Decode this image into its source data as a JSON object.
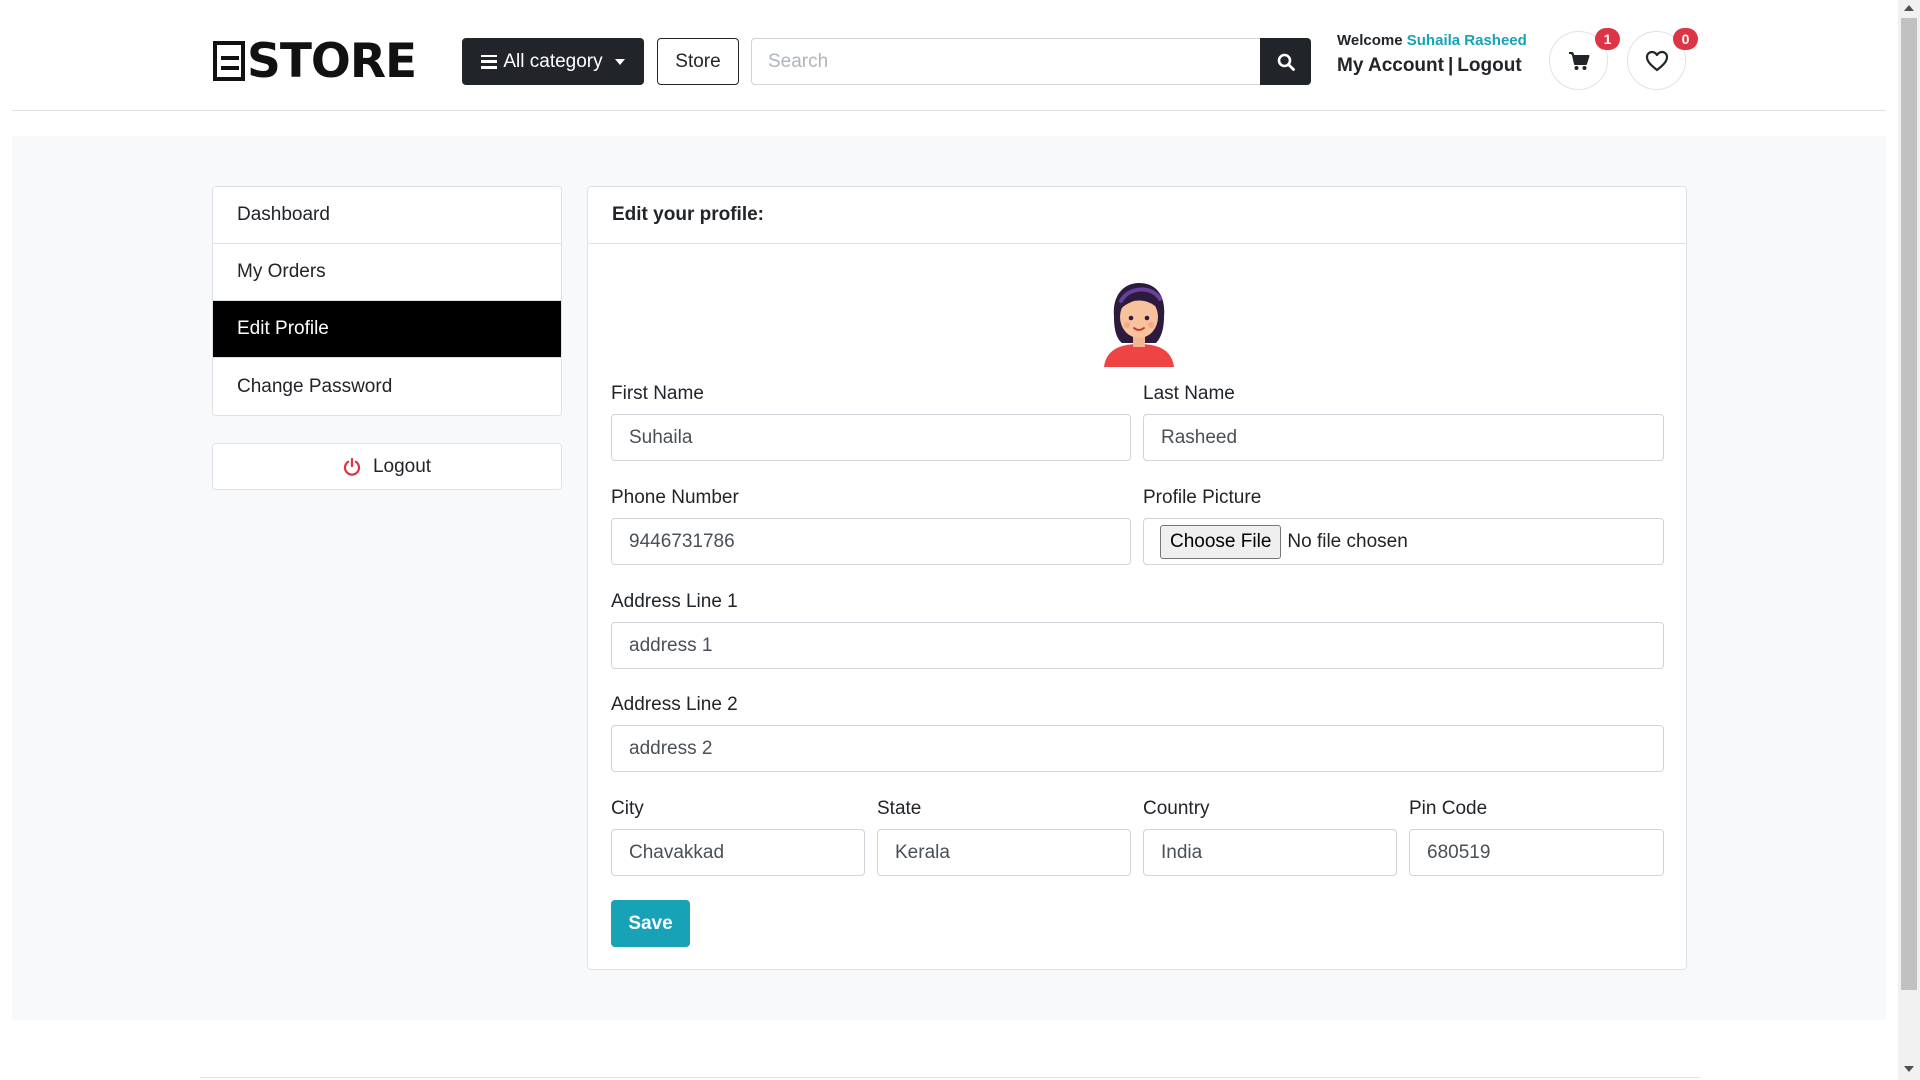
{
  "header": {
    "logo_text": "STORE",
    "category_label": "All category",
    "store_label": "Store",
    "search_placeholder": "Search",
    "welcome_prefix": "Welcome",
    "user_name": "Suhaila Rasheed",
    "my_account_label": "My Account",
    "separator": "|",
    "logout_label": "Logout",
    "cart_count": "1",
    "wishlist_count": "0"
  },
  "sidebar": {
    "items": [
      {
        "label": "Dashboard",
        "active": false
      },
      {
        "label": "My Orders",
        "active": false
      },
      {
        "label": "Edit Profile",
        "active": true
      },
      {
        "label": "Change Password",
        "active": false
      }
    ],
    "logout_label": "Logout"
  },
  "profile": {
    "title": "Edit your profile:",
    "fields": {
      "first_name": {
        "label": "First Name",
        "value": "Suhaila"
      },
      "last_name": {
        "label": "Last Name",
        "value": "Rasheed"
      },
      "phone": {
        "label": "Phone Number",
        "value": "9446731786"
      },
      "picture": {
        "label": "Profile Picture",
        "button": "Choose File",
        "status": "No file chosen"
      },
      "address1": {
        "label": "Address Line 1",
        "value": "address 1"
      },
      "address2": {
        "label": "Address Line 2",
        "value": "address 2"
      },
      "city": {
        "label": "City",
        "value": "Chavakkad"
      },
      "state": {
        "label": "State",
        "value": "Kerala"
      },
      "country": {
        "label": "Country",
        "value": "India"
      },
      "pin": {
        "label": "Pin Code",
        "value": "680519"
      }
    },
    "save_label": "Save"
  },
  "colors": {
    "accent": "#17a2b8",
    "dark": "#212529",
    "badge": "#dc3545",
    "logout_icon": "#dc3545"
  },
  "icons": {
    "category": "hamburger-icon",
    "search": "search-icon",
    "cart": "cart-icon",
    "wishlist": "heart-icon",
    "logout": "power-icon"
  }
}
